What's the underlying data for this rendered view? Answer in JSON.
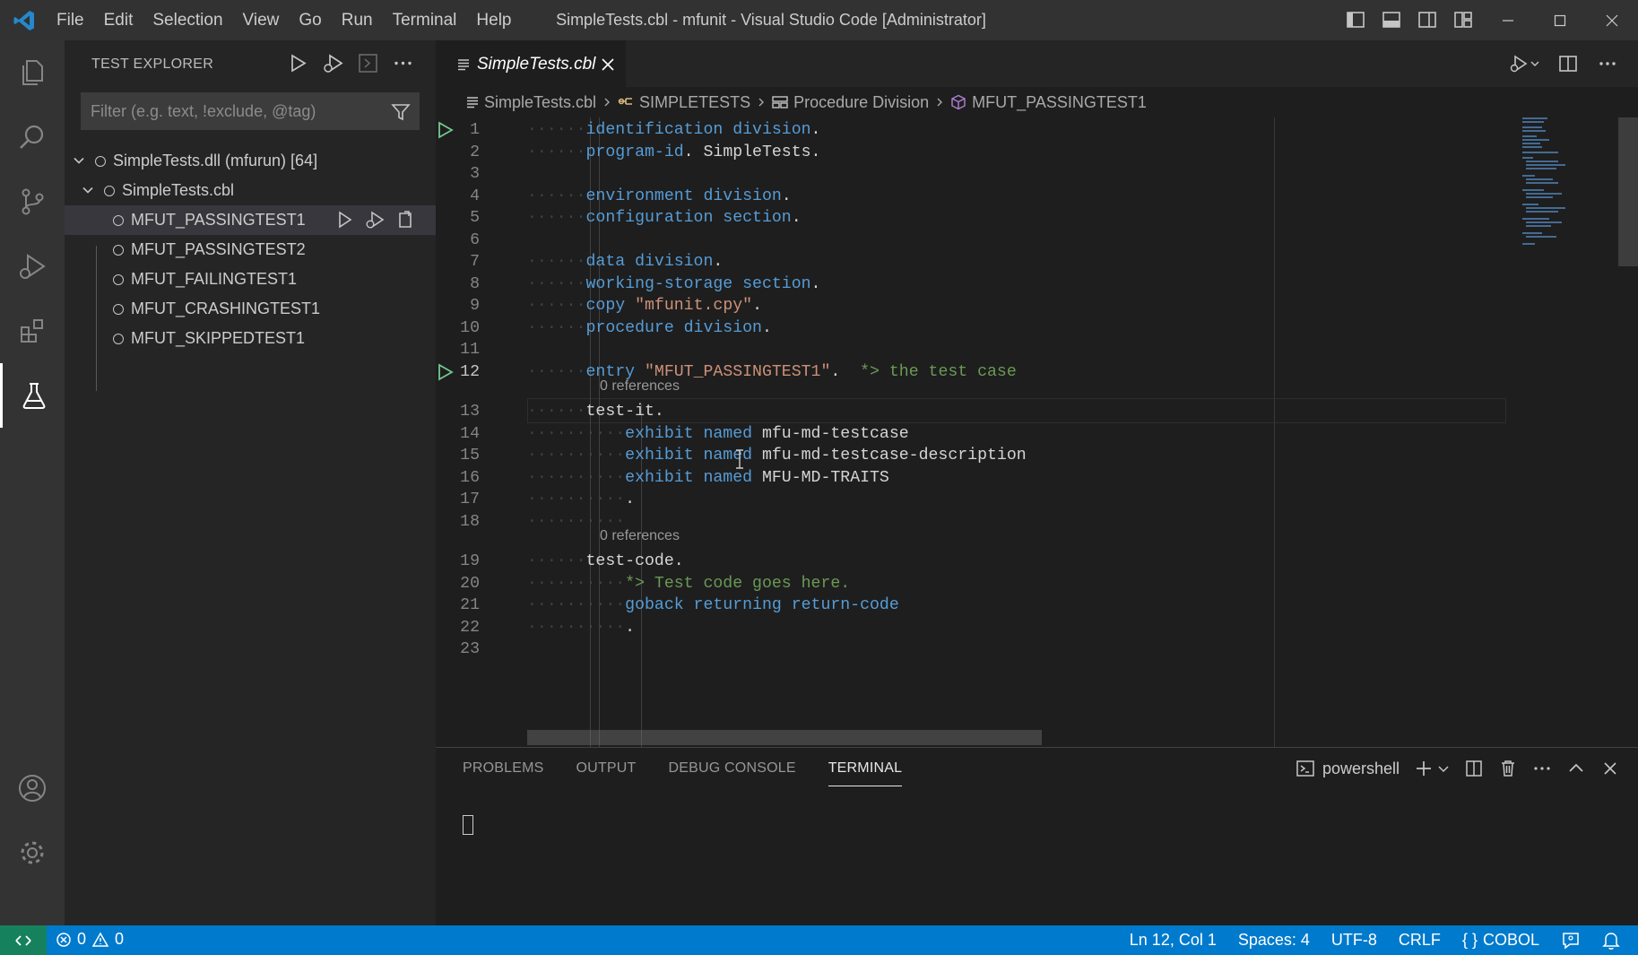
{
  "titlebar": {
    "menu": [
      "File",
      "Edit",
      "Selection",
      "View",
      "Go",
      "Run",
      "Terminal",
      "Help"
    ],
    "title": "SimpleTests.cbl - mfunit - Visual Studio Code [Administrator]"
  },
  "sidebar": {
    "title": "TEST EXPLORER",
    "filter_placeholder": "Filter (e.g. text, !exclude, @tag)",
    "tree": [
      {
        "label": "SimpleTests.dll (mfurun) [64]",
        "level": 0,
        "expanded": true
      },
      {
        "label": "SimpleTests.cbl",
        "level": 1,
        "expanded": true
      },
      {
        "label": "MFUT_PASSINGTEST1",
        "level": 2,
        "selected": true
      },
      {
        "label": "MFUT_PASSINGTEST2",
        "level": 2
      },
      {
        "label": "MFUT_FAILINGTEST1",
        "level": 2
      },
      {
        "label": "MFUT_CRASHINGTEST1",
        "level": 2
      },
      {
        "label": "MFUT_SKIPPEDTEST1",
        "level": 2
      }
    ]
  },
  "editor": {
    "tab_label": "SimpleTests.cbl",
    "breadcrumb": [
      "SimpleTests.cbl",
      "SIMPLETESTS",
      "Procedure Division",
      "MFUT_PASSINGTEST1"
    ],
    "code_lens": "0 references",
    "lines": [
      {
        "n": "1",
        "ws": "······",
        "t": [
          [
            "kw",
            "identification division"
          ],
          [
            "",
            "."
          ]
        ]
      },
      {
        "n": "2",
        "ws": "······",
        "t": [
          [
            "kw",
            "program-id"
          ],
          [
            "",
            ". SimpleTests."
          ]
        ]
      },
      {
        "n": "3",
        "ws": "",
        "t": []
      },
      {
        "n": "4",
        "ws": "······",
        "t": [
          [
            "kw",
            "environment division"
          ],
          [
            "",
            "."
          ]
        ]
      },
      {
        "n": "5",
        "ws": "······",
        "t": [
          [
            "kw",
            "configuration section"
          ],
          [
            "",
            "."
          ]
        ]
      },
      {
        "n": "6",
        "ws": "",
        "t": []
      },
      {
        "n": "7",
        "ws": "······",
        "t": [
          [
            "kw",
            "data division"
          ],
          [
            "",
            "."
          ]
        ]
      },
      {
        "n": "8",
        "ws": "······",
        "t": [
          [
            "kw",
            "working-storage section"
          ],
          [
            "",
            "."
          ]
        ]
      },
      {
        "n": "9",
        "ws": "······",
        "t": [
          [
            "kw",
            "copy"
          ],
          [
            "",
            " "
          ],
          [
            "str",
            "\"mfunit.cpy\""
          ],
          [
            "",
            "."
          ]
        ]
      },
      {
        "n": "10",
        "ws": "······",
        "t": [
          [
            "kw",
            "procedure division"
          ],
          [
            "",
            "."
          ]
        ]
      },
      {
        "n": "11",
        "ws": "",
        "t": []
      },
      {
        "n": "12",
        "ws": "······",
        "t": [
          [
            "kw",
            "entry"
          ],
          [
            "",
            " "
          ],
          [
            "str",
            "\"MFUT_PASSINGTEST1\""
          ],
          [
            "",
            ".  "
          ],
          [
            "cm",
            "*> the test case"
          ]
        ],
        "lens_after": true
      },
      {
        "n": "13",
        "ws": "······",
        "t": [
          [
            "",
            "test-it."
          ]
        ]
      },
      {
        "n": "14",
        "ws": "··········",
        "t": [
          [
            "kw",
            "exhibit named"
          ],
          [
            "",
            " mfu-md-testcase"
          ]
        ]
      },
      {
        "n": "15",
        "ws": "··········",
        "t": [
          [
            "kw",
            "exhibit named"
          ],
          [
            "",
            " mfu-md-testcase-description"
          ]
        ]
      },
      {
        "n": "16",
        "ws": "··········",
        "t": [
          [
            "kw",
            "exhibit named"
          ],
          [
            "",
            " MFU-MD-TRAITS"
          ]
        ]
      },
      {
        "n": "17",
        "ws": "··········",
        "t": [
          [
            "",
            "."
          ]
        ]
      },
      {
        "n": "18",
        "ws": "··········",
        "t": [],
        "lens_after": true
      },
      {
        "n": "19",
        "ws": "······",
        "t": [
          [
            "",
            "test-code."
          ]
        ]
      },
      {
        "n": "20",
        "ws": "··········",
        "t": [
          [
            "cm",
            "*> Test code goes here."
          ]
        ]
      },
      {
        "n": "21",
        "ws": "··········",
        "t": [
          [
            "kw",
            "goback returning return-code"
          ]
        ]
      },
      {
        "n": "22",
        "ws": "··········",
        "t": [
          [
            "",
            "."
          ]
        ]
      },
      {
        "n": "23",
        "ws": "",
        "t": []
      }
    ]
  },
  "panel": {
    "tabs": [
      "PROBLEMS",
      "OUTPUT",
      "DEBUG CONSOLE",
      "TERMINAL"
    ],
    "active_tab": "TERMINAL",
    "shell": "powershell"
  },
  "statusbar": {
    "errors": "0",
    "warnings": "0",
    "position": "Ln 12, Col 1",
    "spaces": "Spaces: 4",
    "encoding": "UTF-8",
    "eol": "CRLF",
    "language": "COBOL"
  },
  "colors": {
    "accent": "#007acc",
    "remote": "#16825d",
    "run_glyph": "#73c991",
    "keyword": "#569cd6",
    "string": "#ce9178",
    "comment": "#6a9955"
  }
}
